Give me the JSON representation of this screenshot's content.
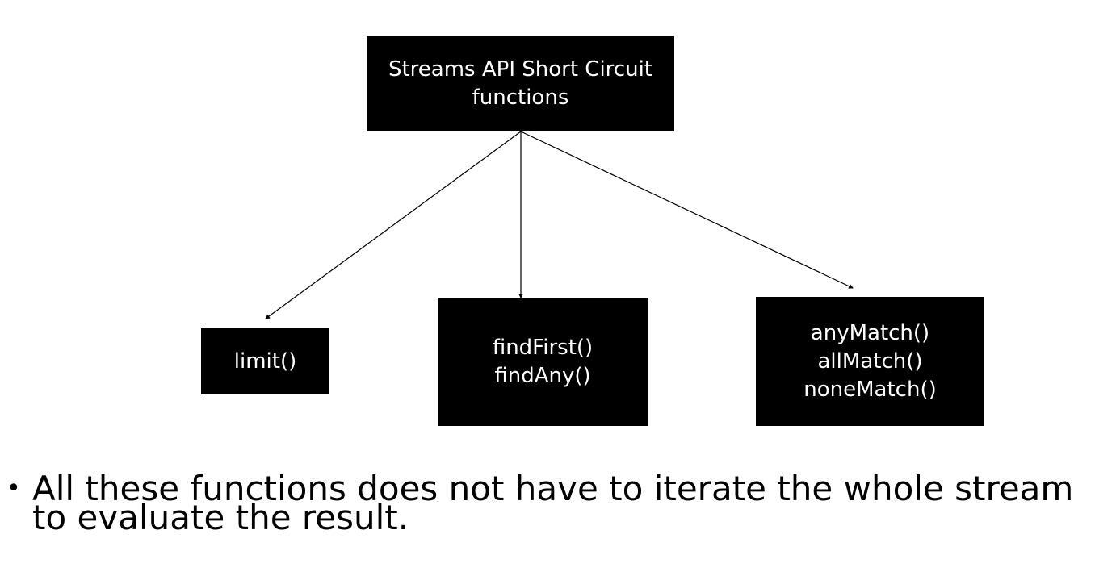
{
  "diagram": {
    "root": {
      "lines": [
        "Streams API Short Circuit",
        "functions"
      ]
    },
    "children": [
      {
        "id": "limit",
        "lines": [
          "limit()"
        ]
      },
      {
        "id": "find",
        "lines": [
          "findFirst()",
          "findAny()"
        ]
      },
      {
        "id": "match",
        "lines": [
          "anyMatch()",
          "allMatch()",
          "noneMatch()"
        ]
      }
    ],
    "colors": {
      "node_fill": "#000000",
      "node_text": "#ffffff",
      "connector": "#000000",
      "background": "#ffffff"
    }
  },
  "bullet": {
    "symbol": "•",
    "text": "All these functions does not have to iterate the whole stream to evaluate the result."
  }
}
